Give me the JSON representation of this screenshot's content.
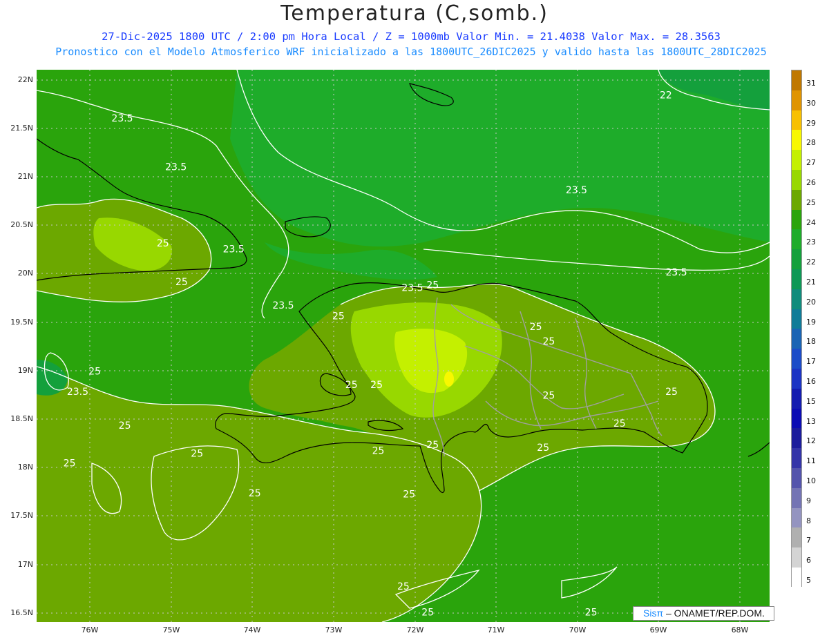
{
  "header": {
    "title": "Temperatura (C,somb.)",
    "line1": "27-Dic-2025  1800 UTC / 2:00 pm Hora Local / Z = 1000mb   Valor Min. = 21.4038  Valor Max. = 28.3563",
    "line2": "Pronostico con el Modelo Atmosferico WRF inicializado a las 1800UTC_26DIC2025 y valido hasta las  1800UTC_28DIC2025"
  },
  "axes": {
    "lat_labels": [
      "22N",
      "21.5N",
      "21N",
      "20.5N",
      "20N",
      "19.5N",
      "19N",
      "18.5N",
      "18N",
      "17.5N",
      "17N",
      "16.5N"
    ],
    "lon_labels": [
      "76W",
      "75W",
      "74W",
      "73W",
      "72W",
      "71W",
      "70W",
      "69W",
      "68W"
    ]
  },
  "contour_labels": [
    {
      "text": "23.5",
      "lon": -75.6,
      "lat": 21.6
    },
    {
      "text": "23.5",
      "lon": -74.94,
      "lat": 21.1
    },
    {
      "text": "25",
      "lon": -75.1,
      "lat": 20.31
    },
    {
      "text": "23.5",
      "lon": -74.23,
      "lat": 20.25
    },
    {
      "text": "25",
      "lon": -74.87,
      "lat": 19.91
    },
    {
      "text": "23.5",
      "lon": -73.62,
      "lat": 19.67
    },
    {
      "text": "23.5",
      "lon": -72.03,
      "lat": 19.85
    },
    {
      "text": "25",
      "lon": -71.78,
      "lat": 19.88
    },
    {
      "text": "25",
      "lon": -72.94,
      "lat": 19.56
    },
    {
      "text": "25",
      "lon": -70.51,
      "lat": 19.45
    },
    {
      "text": "25",
      "lon": -70.35,
      "lat": 19.3
    },
    {
      "text": "25",
      "lon": -75.94,
      "lat": 18.99
    },
    {
      "text": "23.5",
      "lon": -76.15,
      "lat": 18.78
    },
    {
      "text": "25",
      "lon": -72.78,
      "lat": 18.85
    },
    {
      "text": "25",
      "lon": -72.47,
      "lat": 18.85
    },
    {
      "text": "25",
      "lon": -70.35,
      "lat": 18.74
    },
    {
      "text": "25",
      "lon": -68.84,
      "lat": 18.78
    },
    {
      "text": "25",
      "lon": -75.57,
      "lat": 18.43
    },
    {
      "text": "25",
      "lon": -69.48,
      "lat": 18.45
    },
    {
      "text": "25",
      "lon": -71.78,
      "lat": 18.23
    },
    {
      "text": "25",
      "lon": -72.45,
      "lat": 18.17
    },
    {
      "text": "25",
      "lon": -74.68,
      "lat": 18.14
    },
    {
      "text": "25",
      "lon": -70.42,
      "lat": 18.2
    },
    {
      "text": "25",
      "lon": -76.25,
      "lat": 18.04
    },
    {
      "text": "25",
      "lon": -73.97,
      "lat": 17.73
    },
    {
      "text": "25",
      "lon": -72.07,
      "lat": 17.72
    },
    {
      "text": "23.5",
      "lon": -70.01,
      "lat": 20.86
    },
    {
      "text": "23.5",
      "lon": -68.78,
      "lat": 20.01
    },
    {
      "text": "22",
      "lon": -68.91,
      "lat": 21.84
    },
    {
      "text": "25",
      "lon": -72.14,
      "lat": 16.77
    },
    {
      "text": "25",
      "lon": -71.84,
      "lat": 16.5
    },
    {
      "text": "25",
      "lon": -69.83,
      "lat": 16.5
    }
  ],
  "legend": {
    "labels": [
      "31",
      "30",
      "29",
      "28",
      "27",
      "26",
      "25",
      "24",
      "23",
      "22",
      "21",
      "20",
      "19",
      "18",
      "17",
      "16",
      "15",
      "13",
      "12",
      "11",
      "10",
      "9",
      "8",
      "7",
      "6",
      "5"
    ],
    "colors": [
      "#c07800",
      "#e09400",
      "#f8c000",
      "#f8f800",
      "#c4f000",
      "#98d800",
      "#6ca800",
      "#2aa40c",
      "#1eac2a",
      "#14a03c",
      "#0e9856",
      "#108c7c",
      "#107c98",
      "#1a64b4",
      "#1c4cc8",
      "#1c34c4",
      "#141cb0",
      "#0c0cb4",
      "#1c1c9c",
      "#3434a8",
      "#5454ac",
      "#7474b4",
      "#9494c0",
      "#b0b0b0",
      "#d4d4d4",
      "#ffffff"
    ]
  },
  "credit": {
    "sis": "Sisπ",
    "rest": " – ONAMET/REP.DOM."
  }
}
